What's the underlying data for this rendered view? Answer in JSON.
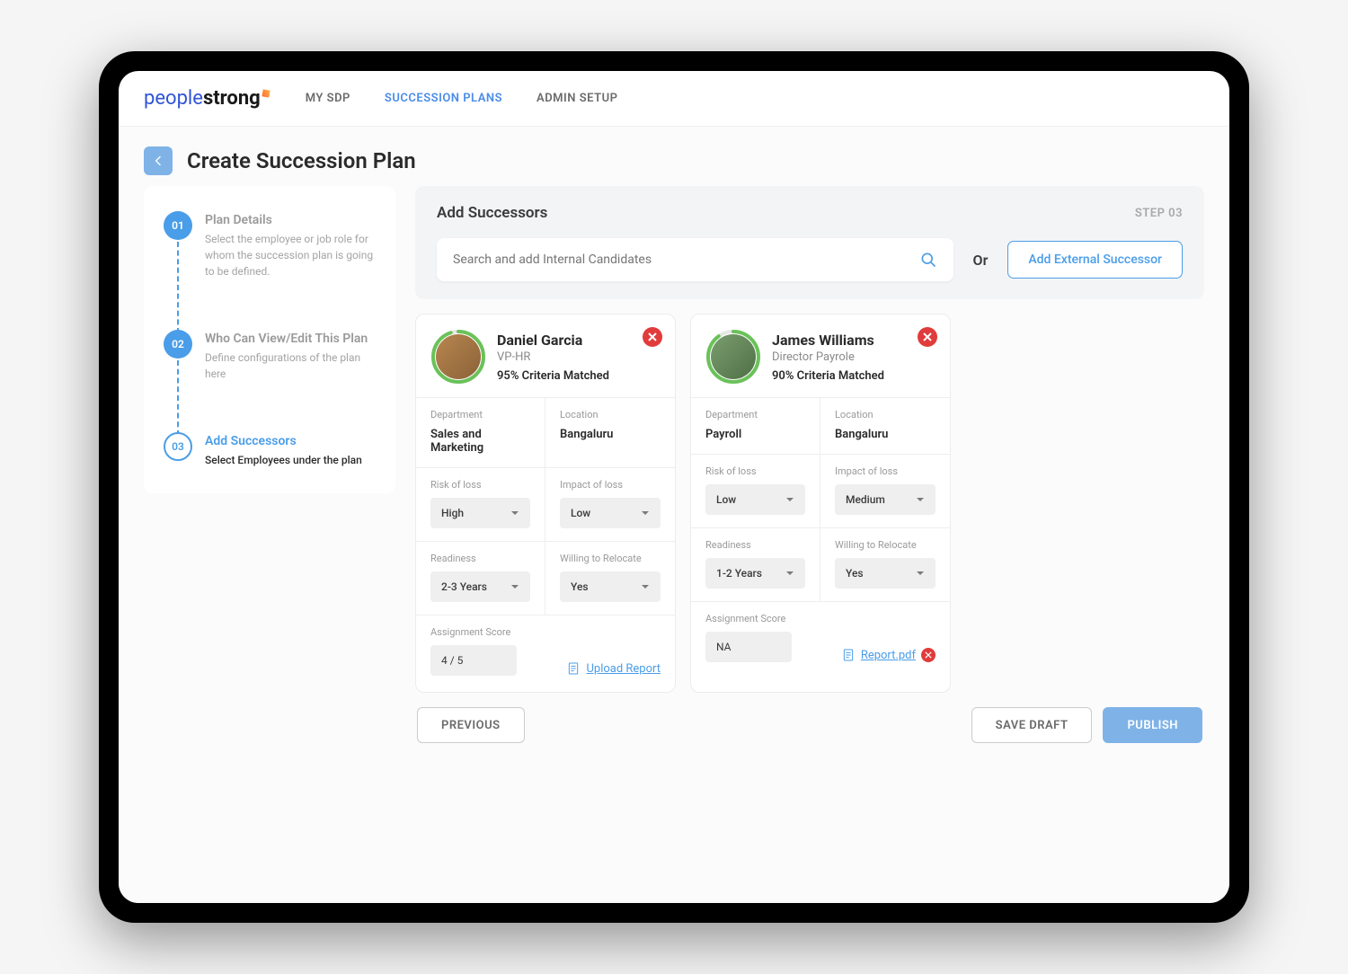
{
  "logo": {
    "part1": "people",
    "part2": "strong"
  },
  "nav": {
    "mysdp": "MY SDP",
    "plans": "SUCCESSION PLANS",
    "admin": "ADMIN SETUP"
  },
  "page_title": "Create Succession Plan",
  "steps": [
    {
      "num": "01",
      "title": "Plan Details",
      "desc": "Select the employee or job role for whom the succession plan is going to be defined."
    },
    {
      "num": "02",
      "title": "Who Can View/Edit This Plan",
      "desc": "Define configurations of the plan here"
    },
    {
      "num": "03",
      "title": "Add Successors",
      "desc": "Select Employees under the plan"
    }
  ],
  "panel": {
    "title": "Add Successors",
    "step_label": "STEP 03",
    "search_placeholder": "Search and add Internal Candidates",
    "or": "Or",
    "ext_btn": "Add External Successor"
  },
  "field_labels": {
    "dept": "Department",
    "loc": "Location",
    "risk": "Risk of loss",
    "impact": "Impact of loss",
    "readiness": "Readiness",
    "relocate": "Willing to Relocate",
    "score": "Assignment Score"
  },
  "successors": [
    {
      "name": "Daniel Garcia",
      "role": "VP-HR",
      "match": "95% Criteria Matched",
      "ring": 95,
      "dept": "Sales and Marketing",
      "loc": "Bangaluru",
      "risk": "High",
      "impact": "Low",
      "readiness": "2-3 Years",
      "relocate": "Yes",
      "score": "4 / 5",
      "upload": "Upload Report",
      "has_file": false
    },
    {
      "name": "James Williams",
      "role": "Director Payrole",
      "match": "90% Criteria Matched",
      "ring": 90,
      "dept": "Payroll",
      "loc": "Bangaluru",
      "risk": "Low",
      "impact": "Medium",
      "readiness": "1-2 Years",
      "relocate": "Yes",
      "score": "NA",
      "upload": "Report.pdf",
      "has_file": true
    }
  ],
  "actions": {
    "prev": "PREVIOUS",
    "save": "SAVE DRAFT",
    "publish": "PUBLISH"
  }
}
